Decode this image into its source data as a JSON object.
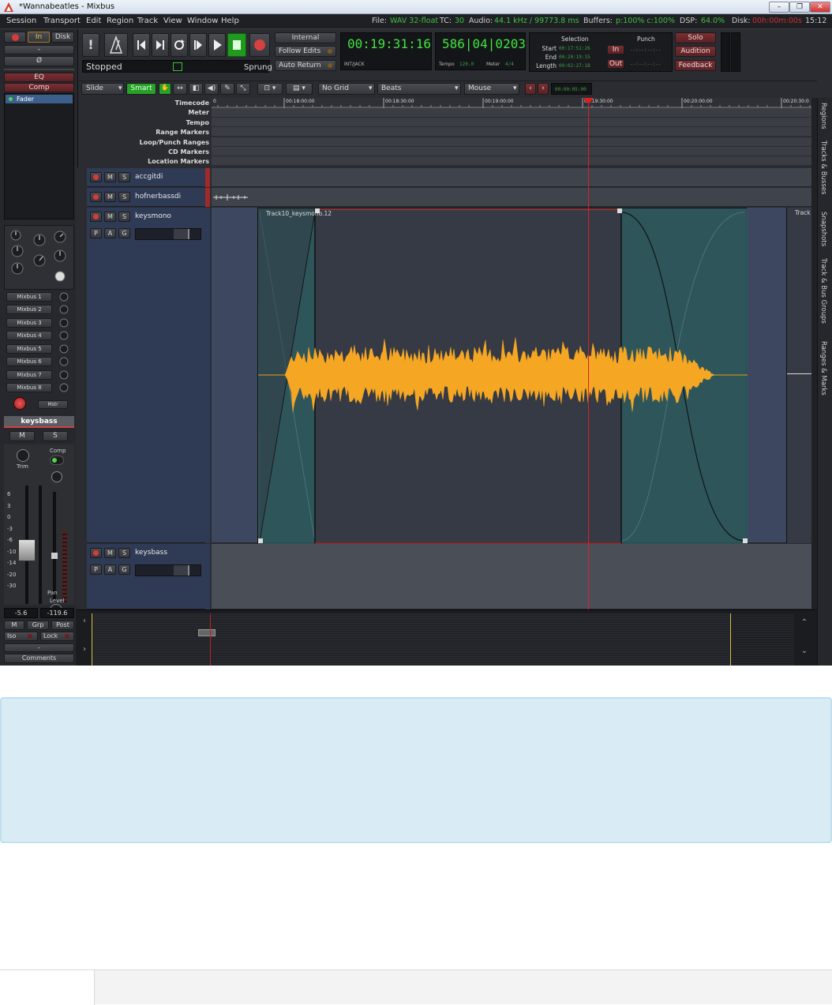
{
  "window": {
    "title": "*Wannabeatles - Mixbus",
    "controls": [
      "–",
      "❐",
      "✕"
    ]
  },
  "menu": [
    "Session",
    "Transport",
    "Edit",
    "Region",
    "Track",
    "View",
    "Window",
    "Help"
  ],
  "status": {
    "file_label": "File:",
    "file_value": "WAV 32-float",
    "tc_label": "TC:",
    "tc_value": "30",
    "audio_label": "Audio:",
    "audio_value": "44.1 kHz / 99773.8 ms",
    "buffers_label": "Buffers:",
    "buffers_value": "p:100% c:100%",
    "dsp_label": "DSP:",
    "dsp_value": "64.0%",
    "disk_label": "Disk:",
    "disk_value": "00h:00m:00s",
    "clock": "15:12"
  },
  "monitor": {
    "in_label": "In",
    "disk_label": "Disk",
    "dash": "-",
    "phase": "Ø"
  },
  "strip_sections": {
    "eq": "EQ",
    "comp": "Comp",
    "fader": "Fader"
  },
  "transport": {
    "state": "Stopped",
    "sprung": "Sprung",
    "internal": "Internal",
    "follow_edits": "Follow Edits",
    "auto_return": "Auto Return",
    "clock_primary": "00:19:31:16",
    "clock_primary_sub": "INT/JACK",
    "clock_secondary": "586|04|0203",
    "tempo_label": "Tempo",
    "tempo_value": "120.0",
    "meter_label": "Meter",
    "meter_value": "4/4"
  },
  "selection": {
    "title": "Selection",
    "start_label": "Start",
    "start_value": "00:17:51:26",
    "end_label": "End",
    "end_value": "00:20:19:15",
    "length_label": "Length",
    "length_value": "00:02:27:18"
  },
  "punch": {
    "title": "Punch",
    "in_label": "In",
    "in_value": "--:--:--:--",
    "out_label": "Out",
    "out_value": "--:--:--:--"
  },
  "monitor_section": {
    "solo": "Solo",
    "audition": "Audition",
    "feedback": "Feedback"
  },
  "toolbar": {
    "edit_mode": "Slide",
    "smart": "Smart",
    "grid": "No Grid",
    "grid_unit": "Beats",
    "edit_point": "Mouse",
    "nudge_clock": "00:00:05:00"
  },
  "ruler_labels": [
    "Timecode",
    "Meter",
    "Tempo",
    "Range Markers",
    "Loop/Punch Ranges",
    "CD Markers",
    "Location Markers"
  ],
  "timecode_ticks": [
    "00:18:00:00",
    "00:18:30:00",
    "00:19:00:00",
    "00:19:30:00",
    "00:20:00:00",
    "00:20:30:0"
  ],
  "timecode_first": "0",
  "tracks": [
    {
      "name": "accgitdi"
    },
    {
      "name": "hofnerbassdi"
    },
    {
      "name": "keysmono",
      "region": "Track10_keysmono.12",
      "edge_region": "Track"
    },
    {
      "name": "keysbass"
    }
  ],
  "track_buttons": {
    "rec": "●",
    "mute": "M",
    "solo": "S",
    "play": "P",
    "auto": "A",
    "group": "G"
  },
  "mixbus_sends": [
    "Mixbus 1",
    "Mixbus 2",
    "Mixbus 3",
    "Mixbus 4",
    "Mixbus 5",
    "Mixbus 6",
    "Mixbus 7",
    "Mixbus 8"
  ],
  "strip": {
    "name": "keysbass",
    "mute": "M",
    "solo": "S",
    "trim_label": "Trim",
    "comp_label": "Comp",
    "level_label": "Level",
    "fader_value": "-5.6",
    "peak_value": "-119.6",
    "m_btn": "M",
    "grp_btn": "Grp",
    "post_btn": "Post",
    "iso_btn": "Iso",
    "lock_btn": "Lock",
    "comments": "Comments",
    "pan_label": "Pan",
    "dash": "-",
    "scale": [
      "6",
      "3",
      "0",
      "-3",
      "-6",
      "-10",
      "-14",
      "-20",
      "-30"
    ]
  },
  "right_tabs": [
    "Regions",
    "Tracks & Busses",
    "Snapshots",
    "Track & Bus Groups",
    "Ranges & Marks"
  ],
  "summary_nav": {
    "left": "‹",
    "right": "›",
    "up": "⌃",
    "down": "⌄"
  },
  "colors": {
    "accent_green": "#3ee63e",
    "playhead": "#e02020",
    "waveform": "#f5a623",
    "track_header": "#2f3a55",
    "region_fill": "#353a44",
    "fade_fill": "#2c5a5e"
  }
}
